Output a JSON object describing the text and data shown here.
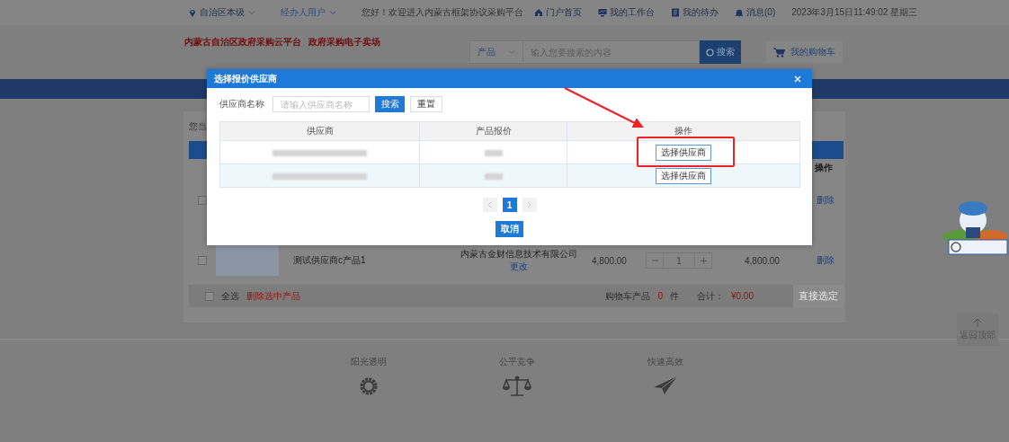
{
  "top_bar": {
    "region": "自治区本级",
    "user": "经办人用户",
    "welcome": "您好！欢迎进入内蒙古框架协议采购平台",
    "links": [
      {
        "label": "门户首页"
      },
      {
        "label": "我的工作台"
      },
      {
        "label": "我的待办"
      },
      {
        "label": "消息(0)"
      }
    ],
    "datetime": "2023年3月15日11:49:02 星期三"
  },
  "header": {
    "logo_titles": [
      "内蒙古自治区政府采购云平台",
      "政府采购电子卖场"
    ],
    "search_category": "产品",
    "search_placeholder": "输入您要搜索的内容",
    "search_button": "搜索",
    "cart_link": "我的购物车"
  },
  "cart": {
    "breadcrumb": "您当",
    "action_header": "操作",
    "rows": [
      {
        "kind": "covered",
        "checked": false,
        "action": "删除"
      },
      {
        "kind": "full",
        "checked": false,
        "product": "测试供应商c产品1",
        "supplier": "内蒙古金财信息技术有限公司",
        "change": "更改",
        "price": "4,800.00",
        "quantity": "1",
        "subtotal": "4,800.00",
        "action": "删除"
      }
    ],
    "select_all": {
      "label": "全选",
      "checked": false
    },
    "delete_selected": "删除选中产品",
    "count_label": "购物车产品",
    "count": "0",
    "count_unit": "件",
    "total_label": "合计：",
    "total": "¥0.00",
    "submit": "直接选定"
  },
  "features": [
    {
      "label": "阳光透明"
    },
    {
      "label": "公平竞争"
    },
    {
      "label": "快速高效"
    }
  ],
  "back_to_top": "返回顶部",
  "modal": {
    "title": "选择报价供应商",
    "filter_label": "供应商名称",
    "filter_placeholder": "请输入供应商名称",
    "search_button": "搜索",
    "reset_button": "重置",
    "columns": [
      "供应商",
      "产品报价",
      "操作"
    ],
    "rows": [
      {
        "action": "选择供应商",
        "highlighted": true
      },
      {
        "action": "选择供应商",
        "highlighted": false
      }
    ],
    "pages": [
      {
        "label": "1",
        "selected": true
      }
    ],
    "cancel": "取消"
  }
}
